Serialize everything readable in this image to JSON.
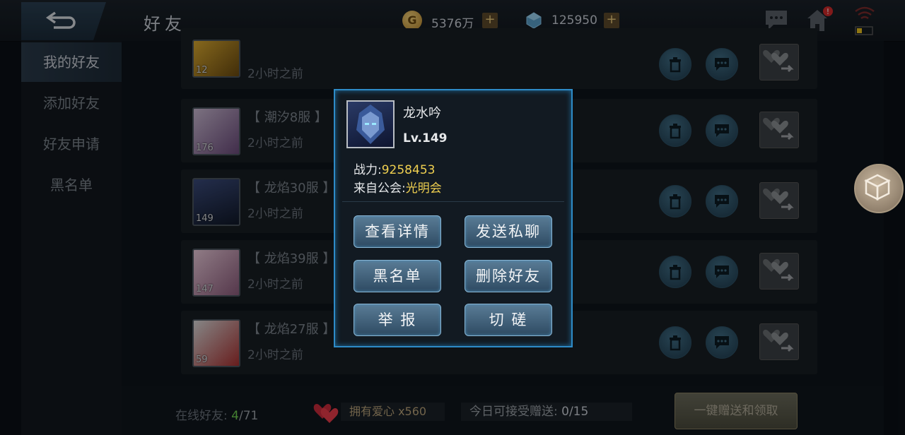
{
  "header": {
    "title": "好友",
    "gold": "5376万",
    "gold_icon": "G",
    "gems": "125950",
    "plus": "+"
  },
  "sidebar": {
    "items": [
      {
        "label": "我的好友",
        "active": true
      },
      {
        "label": "添加好友",
        "active": false
      },
      {
        "label": "好友申请",
        "active": false
      },
      {
        "label": "黑名单",
        "active": false
      }
    ]
  },
  "friends": [
    {
      "level": "12",
      "server": "",
      "time": "2小时之前"
    },
    {
      "level": "176",
      "server": "【 潮汐8服 】",
      "time": "2小时之前"
    },
    {
      "level": "149",
      "server": "【 龙焰30服 】",
      "time": "2小时之前"
    },
    {
      "level": "147",
      "server": "【 龙焰39服 】",
      "time": "2小时之前"
    },
    {
      "level": "59",
      "server": "【 龙焰27服 】",
      "time": "2小时之前"
    }
  ],
  "footer": {
    "online_label": "在线好友:",
    "online_count": "4",
    "online_total": "/71",
    "hearts_label": "拥有爱心 x560",
    "receive_label": "今日可接受赠送:",
    "receive_value": "0/15",
    "onekey_label": "一键赠送和领取"
  },
  "popup": {
    "name": "龙水吟",
    "level": "Lv.149",
    "power_label": "战力:",
    "power_value": "9258453",
    "guild_label": "来自公会:",
    "guild_value": "光明会",
    "buttons": {
      "details": "查看详情",
      "chat": "发送私聊",
      "blacklist": "黑名单",
      "delete": "删除好友",
      "report": "举 报",
      "duel": "切 磋"
    }
  },
  "colors": {
    "accent": "#2e8bc7",
    "highlight": "#f0d050",
    "online": "#6fcf50"
  }
}
